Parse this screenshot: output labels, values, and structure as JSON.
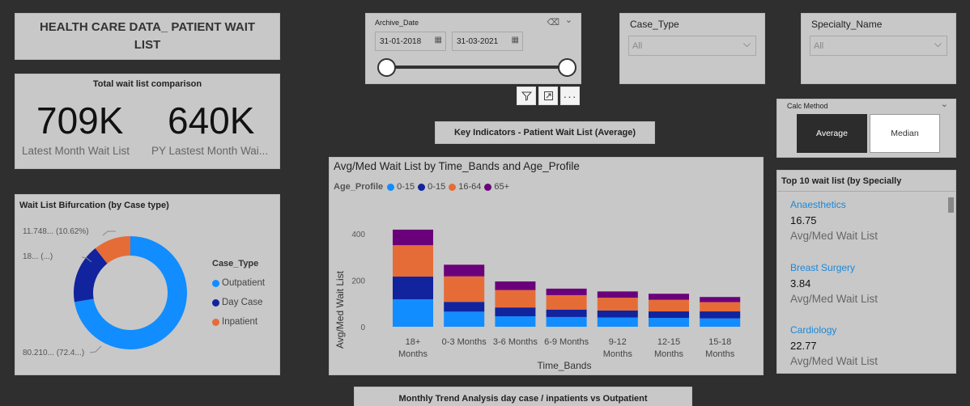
{
  "header": {
    "title": "HEALTH CARE DATA_ PATIENT WAIT LIST"
  },
  "kpi": {
    "title": "Total wait list comparison",
    "latest_value": "709K",
    "latest_label": "Latest Month Wait List",
    "py_value": "640K",
    "py_label": "PY Lastest Month Wai..."
  },
  "archive_slicer": {
    "label": "Archive_Date",
    "start": "31-01-2018",
    "end": "31-03-2021",
    "range_start_fraction": 0,
    "range_end_fraction": 1
  },
  "case_type_slicer": {
    "label": "Case_Type",
    "value": "All"
  },
  "specialty_slicer": {
    "label": "Specialty_Name",
    "value": "All"
  },
  "key_indicators": {
    "title": "Key Indicators - Patient Wait List (Average)"
  },
  "calc_method": {
    "label": "Calc Method",
    "options": [
      "Average",
      "Median"
    ],
    "selected": "Average"
  },
  "donut": {
    "title": "Wait List Bifurcation (by Case type)",
    "legend_title": "Case_Type",
    "labels": [
      "11.748... (10.62%)",
      "18... (...)",
      "80.210... (72.4...)"
    ]
  },
  "bar_chart": {
    "title": "Avg/Med Wait List by Time_Bands and Age_Profile",
    "legend_title": "Age_Profile",
    "xlabel": "Time_Bands",
    "ylabel": "Avg/Med Wait List"
  },
  "top10": {
    "title": "Top 10 wait list (by  Specially",
    "items": [
      {
        "name": "Anaesthetics",
        "value": "16.75",
        "label": "Avg/Med Wait List"
      },
      {
        "name": "Breast Surgery",
        "value": "3.84",
        "label": "Avg/Med Wait List"
      },
      {
        "name": "Cardiology",
        "value": "22.77",
        "label": "Avg/Med Wait List"
      }
    ]
  },
  "trend": {
    "title": "Monthly Trend Analysis day case / inpatients  vs Outpatient"
  },
  "chart_data": [
    {
      "type": "bar",
      "stacked": true,
      "categories": [
        "18+ Months",
        "0-3 Months",
        "3-6 Months",
        "6-9 Months",
        "9-12 Months",
        "12-15 Months",
        "15-18 Months"
      ],
      "series": [
        {
          "name": "0-15",
          "color": "#118dff",
          "values": [
            118,
            65,
            45,
            42,
            40,
            38,
            36
          ]
        },
        {
          "name": "0-15",
          "color": "#12239e",
          "values": [
            98,
            42,
            38,
            32,
            30,
            28,
            30
          ]
        },
        {
          "name": "16-64",
          "color": "#e66c37",
          "values": [
            135,
            110,
            75,
            62,
            55,
            50,
            40
          ]
        },
        {
          "name": "65+",
          "color": "#6b007b",
          "values": [
            67,
            50,
            37,
            28,
            27,
            26,
            22
          ]
        }
      ],
      "title": "Avg/Med Wait List by Time_Bands and Age_Profile",
      "xlabel": "Time_Bands",
      "ylabel": "Avg/Med Wait List",
      "yticks": [
        0,
        200,
        400
      ],
      "ylim": [
        0,
        470
      ],
      "legend_title": "Age_Profile",
      "legend_position": "top-left",
      "grid": false
    },
    {
      "type": "pie",
      "donut": true,
      "categories": [
        "Outpatient",
        "Day Case",
        "Inpatient"
      ],
      "values": [
        72.4,
        16.98,
        10.62
      ],
      "colors": [
        "#118dff",
        "#12239e",
        "#e66c37"
      ],
      "title": "Wait List Bifurcation (by Case type)",
      "legend_title": "Case_Type",
      "legend_position": "right"
    }
  ]
}
